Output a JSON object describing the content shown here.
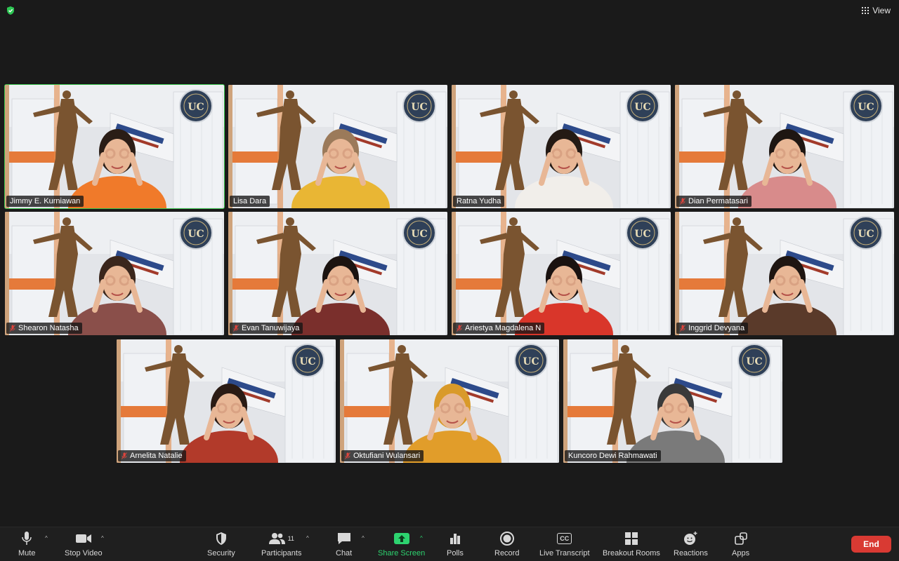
{
  "top": {
    "view_label": "View"
  },
  "participants": [
    {
      "name": "Jimmy E. Kurniawan",
      "muted": false,
      "active": true,
      "shirt": "#f07a2a",
      "hair": "#2a1d16"
    },
    {
      "name": "Lisa Dara",
      "muted": false,
      "active": false,
      "shirt": "#e9b634",
      "hair": "#9b7a5a"
    },
    {
      "name": "Ratna Yudha",
      "muted": false,
      "active": false,
      "shirt": "#f1eeea",
      "hair": "#241a14"
    },
    {
      "name": "Dian Permatasari",
      "muted": true,
      "active": false,
      "shirt": "#d88b8b",
      "hair": "#1e1612"
    },
    {
      "name": "Shearon Natasha",
      "muted": true,
      "active": false,
      "shirt": "#8a4f4a",
      "hair": "#3a261c"
    },
    {
      "name": "Evan Tanuwijaya",
      "muted": true,
      "active": false,
      "shirt": "#7a2f2c",
      "hair": "#1b1310"
    },
    {
      "name": "Ariestya Magdalena N",
      "muted": true,
      "active": false,
      "shirt": "#d9362a",
      "hair": "#1a1210"
    },
    {
      "name": "Inggrid Devyana",
      "muted": true,
      "active": false,
      "shirt": "#5a3a2a",
      "hair": "#1e1511"
    },
    {
      "name": "Arnelita Natalie",
      "muted": true,
      "active": false,
      "shirt": "#b23a2a",
      "hair": "#2a1b14"
    },
    {
      "name": "Oktufiani Wulansari",
      "muted": true,
      "active": false,
      "shirt": "#e19d2a",
      "hair": "#d99a2a"
    },
    {
      "name": "Kuncoro Dewi Rahmawati",
      "muted": false,
      "active": false,
      "shirt": "#7a7a7a",
      "hair": "#3a3a3a"
    }
  ],
  "toolbar": {
    "mute": "Mute",
    "stop_video": "Stop Video",
    "security": "Security",
    "participants": "Participants",
    "participants_count": "11",
    "chat": "Chat",
    "share_screen": "Share Screen",
    "polls": "Polls",
    "record": "Record",
    "live_transcript": "Live Transcript",
    "breakout_rooms": "Breakout Rooms",
    "reactions": "Reactions",
    "apps": "Apps",
    "end": "End",
    "cc_glyph": "CC"
  },
  "colors": {
    "accent_green": "#2dd36f",
    "active_border": "#37c14a",
    "end_red": "#d93a33"
  }
}
